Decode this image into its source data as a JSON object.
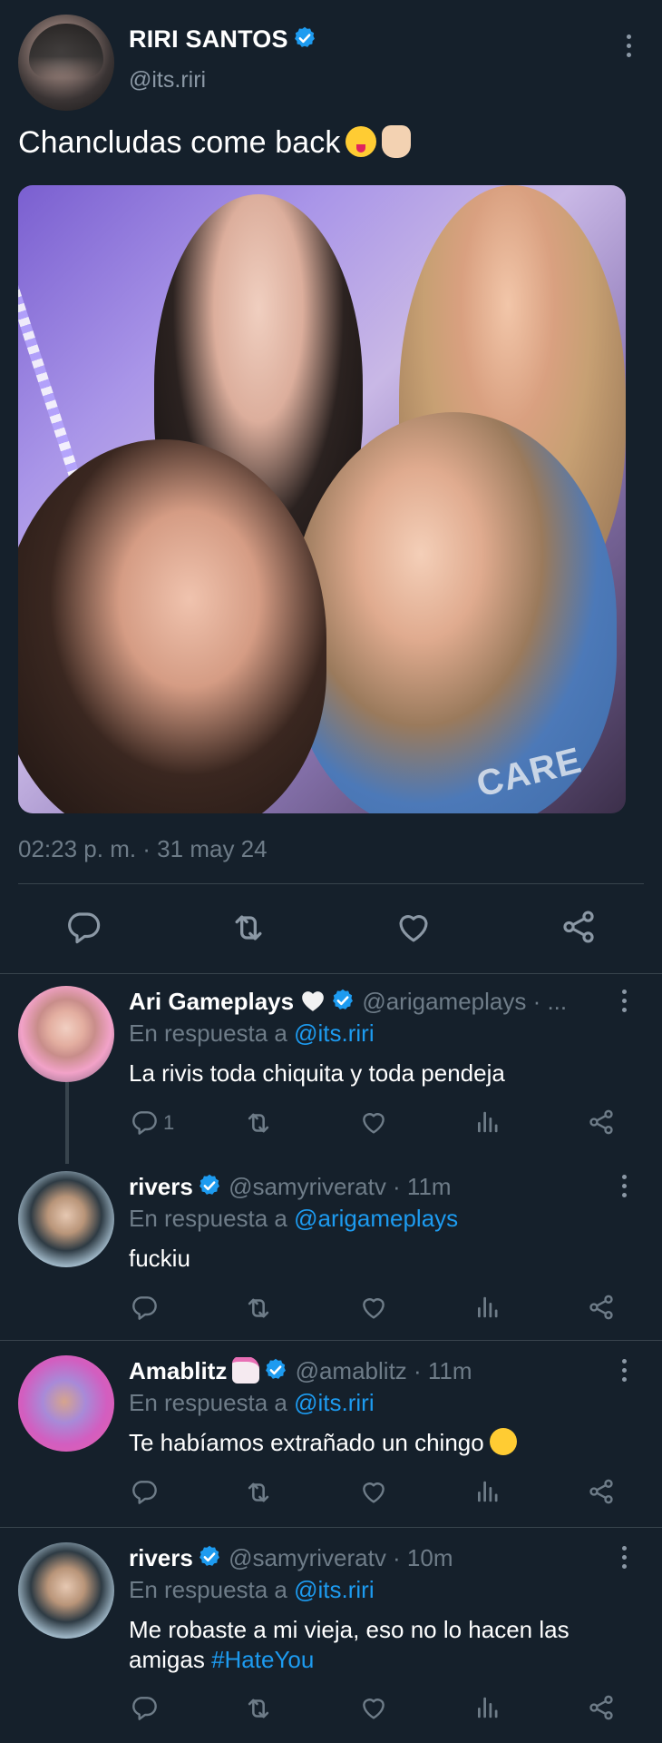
{
  "tweet": {
    "author": {
      "name": "RIRI SANTOS",
      "handle": "@its.riri",
      "verified": true
    },
    "text": "Chancludas come back",
    "emojis": [
      "squinting-tongue-emoji",
      "rock-hand-emoji"
    ],
    "image": {
      "shirt_text": "CARE"
    },
    "timestamp": "02:23 p. m. · 31 may 24",
    "actions": [
      "reply",
      "retweet",
      "like",
      "share"
    ]
  },
  "replies": [
    {
      "name": "Ari Gameplays",
      "name_emoji": "white-heart-emoji",
      "verified": true,
      "meta": "@arigameplays · ...",
      "in_reply_prefix": "En respuesta a",
      "in_reply_to": "@its.riri",
      "text": "La rivis toda chiquita y toda pendeja",
      "reply_count": "1"
    },
    {
      "name": "rivers",
      "verified": true,
      "meta": "@samyriveratv · 11m",
      "in_reply_prefix": "En respuesta a",
      "in_reply_to": "@arigameplays",
      "text": "fuckiu",
      "reply_count": ""
    },
    {
      "name": "Amablitz",
      "name_emoji": "unicorn-emoji",
      "verified": true,
      "meta": "@amablitz · 11m",
      "in_reply_prefix": "En respuesta a",
      "in_reply_to": "@its.riri",
      "text": "Te habíamos extrañado un chingo",
      "text_emoji": "pleading-face-emoji",
      "reply_count": ""
    },
    {
      "name": "rivers",
      "verified": true,
      "meta": "@samyriveratv · 10m",
      "in_reply_prefix": "En respuesta a",
      "in_reply_to": "@its.riri",
      "text_before_hashtag": "Me robaste a mi vieja, eso no lo hacen las amigas",
      "hashtag": "#HateYou",
      "reply_count": ""
    }
  ],
  "colors": {
    "background": "#15202b",
    "text": "#ffffff",
    "muted": "#6e7c88",
    "accent": "#1d9bf0",
    "divider": "#38444d"
  }
}
